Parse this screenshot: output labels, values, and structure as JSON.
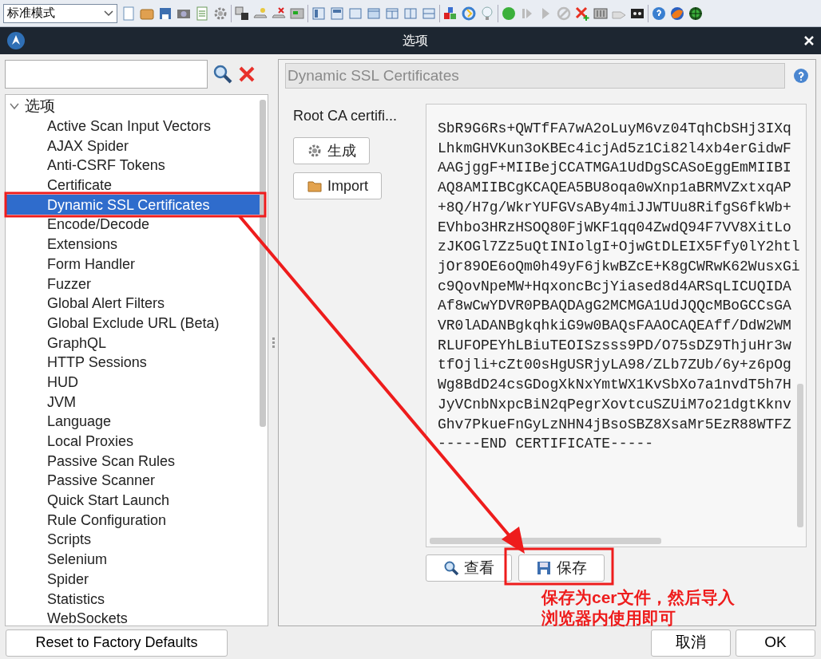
{
  "toolbar": {
    "mode_select": {
      "value": "标准模式"
    }
  },
  "window": {
    "title": "选项"
  },
  "tree": {
    "label": "选项",
    "expanded": true,
    "children": [
      {
        "label": "Active Scan Input Vectors",
        "selected": false
      },
      {
        "label": "AJAX Spider",
        "selected": false
      },
      {
        "label": "Anti-CSRF Tokens",
        "selected": false
      },
      {
        "label": "Certificate",
        "selected": false
      },
      {
        "label": "Dynamic SSL Certificates",
        "selected": true
      },
      {
        "label": "Encode/Decode",
        "selected": false
      },
      {
        "label": "Extensions",
        "selected": false
      },
      {
        "label": "Form Handler",
        "selected": false
      },
      {
        "label": "Fuzzer",
        "selected": false
      },
      {
        "label": "Global Alert Filters",
        "selected": false
      },
      {
        "label": "Global Exclude URL (Beta)",
        "selected": false
      },
      {
        "label": "GraphQL",
        "selected": false
      },
      {
        "label": "HTTP Sessions",
        "selected": false
      },
      {
        "label": "HUD",
        "selected": false
      },
      {
        "label": "JVM",
        "selected": false
      },
      {
        "label": "Language",
        "selected": false
      },
      {
        "label": "Local Proxies",
        "selected": false
      },
      {
        "label": "Passive Scan Rules",
        "selected": false
      },
      {
        "label": "Passive Scanner",
        "selected": false
      },
      {
        "label": "Quick Start Launch",
        "selected": false
      },
      {
        "label": "Rule Configuration",
        "selected": false
      },
      {
        "label": "Scripts",
        "selected": false
      },
      {
        "label": "Selenium",
        "selected": false
      },
      {
        "label": "Spider",
        "selected": false
      },
      {
        "label": "Statistics",
        "selected": false
      },
      {
        "label": "WebSockets",
        "selected": false
      }
    ]
  },
  "panel": {
    "title": "Dynamic SSL Certificates",
    "root_ca_label": "Root CA certifi...",
    "buttons": [
      {
        "label": "生成",
        "kind": "gear"
      },
      {
        "label": "Import",
        "kind": "folder"
      }
    ],
    "certificate_lines": [
      "SbR9G6Rs+QWTfFA7wA2oLuyM6vz04TqhCbSHj3IXq",
      "LhkmGHVKun3oKBEc4icjAd5z1Ci82l4xb4erGidwF",
      "AAGjggF+MIIBejCCATMGA1UdDgSCASoEggEmMIIBI",
      "AQ8AMIIBCgKCAQEA5BU8oqa0wXnp1aBRMVZxtxqAP",
      "+8Q/H7g/WkrYUFGVsABy4miJJWTUu8RifgS6fkWb+",
      "EVhbo3HRzHSOQ80FjWKF1qq04ZwdQ94F7VV8XitLo",
      "zJKOGl7Zz5uQtINIolgI+OjwGtDLEIX5Ffy0lY2htl",
      "jOr89OE6oQm0h49yF6jkwBZcE+K8gCWRwK62WusxGi",
      "c9QovNpeMW+HqxoncBcjYiased8d4ARSqLICUQIDA",
      "Af8wCwYDVR0PBAQDAgG2MCMGA1UdJQQcMBoGCCsGA",
      "VR0lADANBgkqhkiG9w0BAQsFAAOCAQEAff/DdW2WM",
      "RLUFOPEYhLBiuTEOISzsss9PD/O75sDZ9ThjuHr3w",
      "tfOjli+cZt00sHgUSRjyLA98/ZLb7ZUb/6y+z6pOg",
      "Wg8BdD24csGDogXkNxYmtWX1KvSbXo7a1nvdT5h7H",
      "JyVCnbNxpcBiN2qPegrXovtcuSZUiM7o21dgtKknv",
      "Ghv7PkueFnGyLzNHN4jBsoSBZ8XsaMr5EzR88WTFZ",
      "-----END CERTIFICATE-----"
    ],
    "actions": [
      {
        "label": "查看",
        "kind": "view"
      },
      {
        "label": "保存",
        "kind": "save"
      }
    ]
  },
  "footer": {
    "reset": "Reset to Factory Defaults",
    "buttons": [
      "取消",
      "OK"
    ]
  },
  "annotation": {
    "lines": [
      "保存为cer文件，然后导入",
      "浏览器内使用即可"
    ]
  }
}
